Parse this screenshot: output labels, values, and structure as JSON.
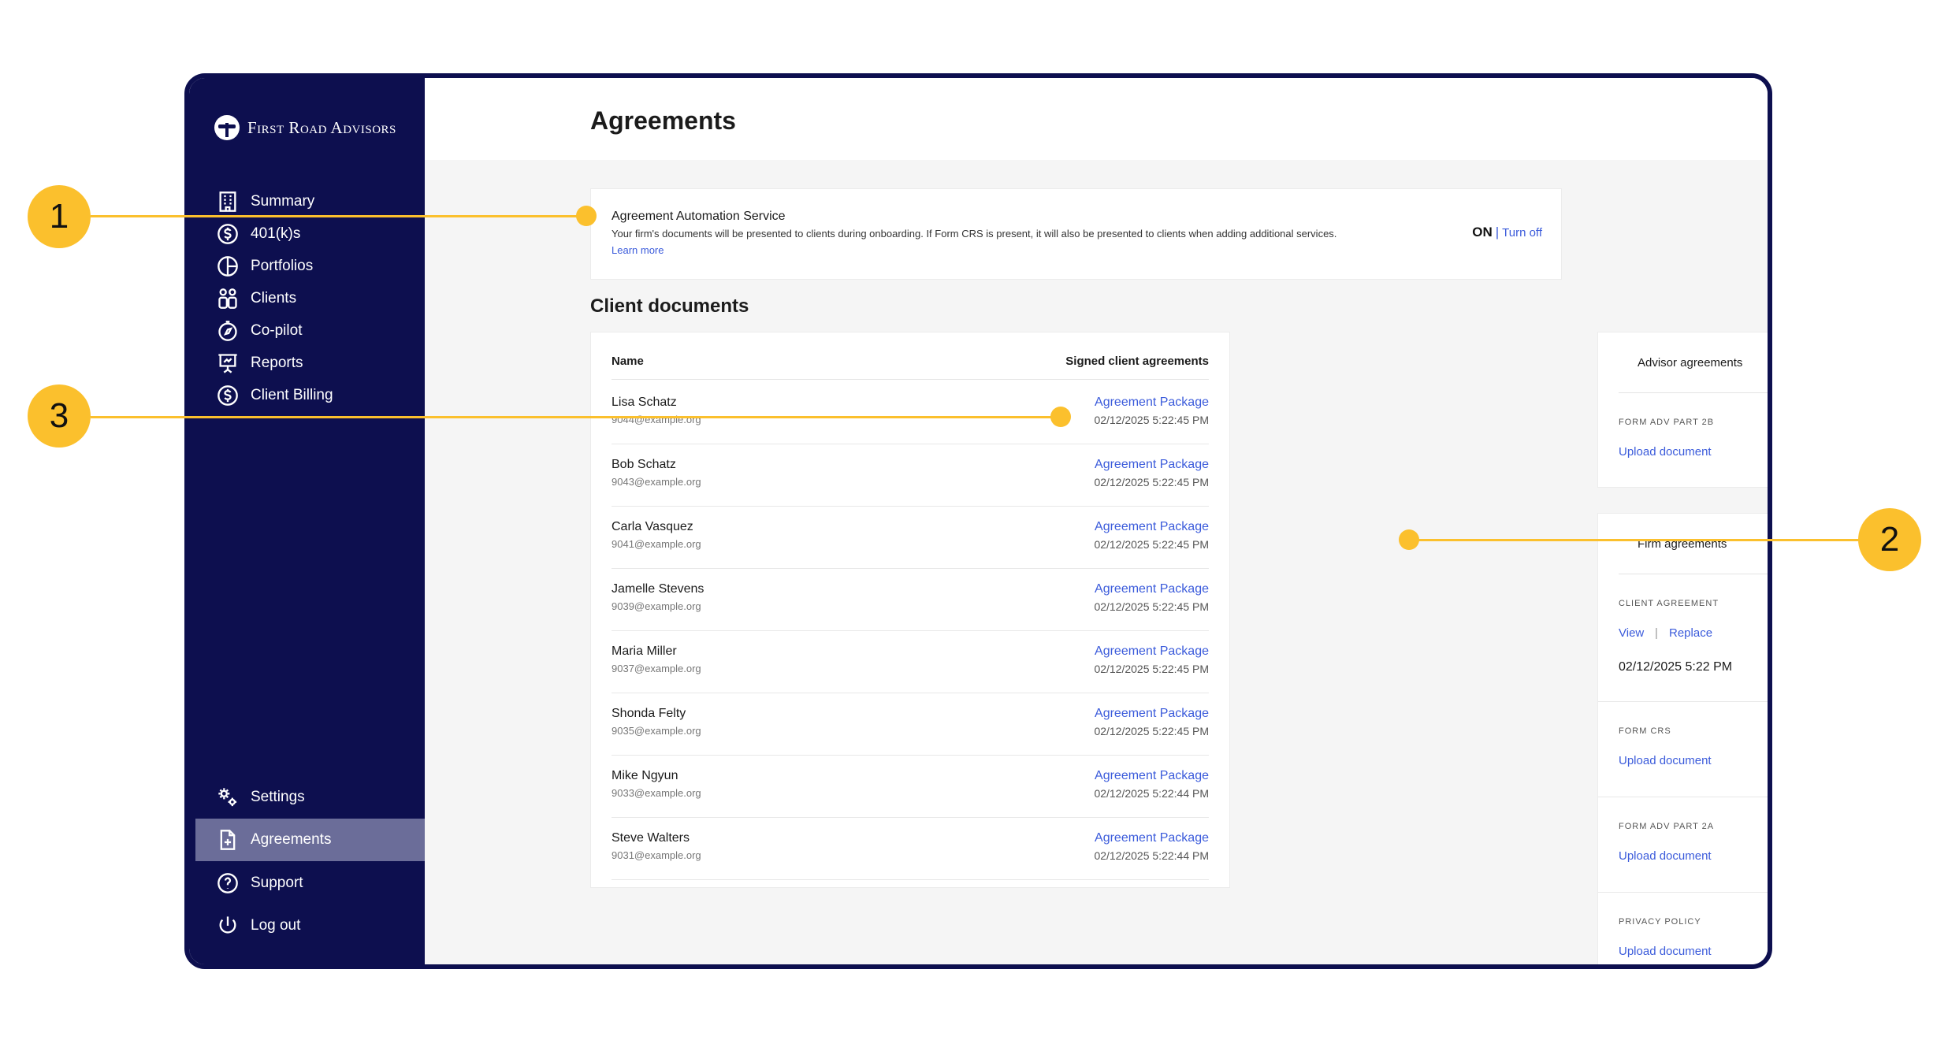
{
  "brand": {
    "name": "First Road Advisors"
  },
  "sidebar": {
    "items": [
      {
        "label": "Summary",
        "icon": "building-icon"
      },
      {
        "label": "401(k)s",
        "icon": "dollar-circle-icon"
      },
      {
        "label": "Portfolios",
        "icon": "pie-chart-icon"
      },
      {
        "label": "Clients",
        "icon": "people-icon"
      },
      {
        "label": "Co-pilot",
        "icon": "compass-icon"
      },
      {
        "label": "Reports",
        "icon": "presentation-icon"
      },
      {
        "label": "Client Billing",
        "icon": "dollar-circle-icon"
      }
    ],
    "bottom_items": [
      {
        "label": "Settings",
        "icon": "gears-icon"
      },
      {
        "label": "Agreements",
        "icon": "document-plus-icon",
        "active": true
      },
      {
        "label": "Support",
        "icon": "question-circle-icon"
      },
      {
        "label": "Log out",
        "icon": "power-icon"
      }
    ]
  },
  "page": {
    "title": "Agreements"
  },
  "automation": {
    "title": "Agreement Automation Service",
    "description": "Your firm's documents will be presented to clients during onboarding. If Form CRS is present, it will also be presented to clients when adding additional services.",
    "learn_more": "Learn more",
    "status": "ON",
    "separator": "|",
    "toggle_label": "Turn off"
  },
  "client_documents": {
    "title": "Client documents",
    "col_name": "Name",
    "col_signed": "Signed client agreements",
    "rows": [
      {
        "name": "Lisa Schatz",
        "email": "9044@example.org",
        "package": "Agreement Package",
        "date": "02/12/2025 5:22:45 PM"
      },
      {
        "name": "Bob Schatz",
        "email": "9043@example.org",
        "package": "Agreement Package",
        "date": "02/12/2025 5:22:45 PM"
      },
      {
        "name": "Carla Vasquez",
        "email": "9041@example.org",
        "package": "Agreement Package",
        "date": "02/12/2025 5:22:45 PM"
      },
      {
        "name": "Jamelle Stevens",
        "email": "9039@example.org",
        "package": "Agreement Package",
        "date": "02/12/2025 5:22:45 PM"
      },
      {
        "name": "Maria Miller",
        "email": "9037@example.org",
        "package": "Agreement Package",
        "date": "02/12/2025 5:22:45 PM"
      },
      {
        "name": "Shonda Felty",
        "email": "9035@example.org",
        "package": "Agreement Package",
        "date": "02/12/2025 5:22:45 PM"
      },
      {
        "name": "Mike Ngyun",
        "email": "9033@example.org",
        "package": "Agreement Package",
        "date": "02/12/2025 5:22:44 PM"
      },
      {
        "name": "Steve Walters",
        "email": "9031@example.org",
        "package": "Agreement Package",
        "date": "02/12/2025 5:22:44 PM"
      }
    ]
  },
  "advisor_agreements": {
    "title": "Advisor agreements",
    "form_label": "FORM ADV PART 2B",
    "upload": "Upload document"
  },
  "firm_agreements": {
    "title": "Firm agreements",
    "client_agreement_label": "CLIENT AGREEMENT",
    "view": "View",
    "separator": "|",
    "replace": "Replace",
    "client_agreement_date": "02/12/2025 5:22 PM",
    "form_crs_label": "FORM CRS",
    "form_crs_upload": "Upload document",
    "adv2a_label": "FORM ADV PART 2A",
    "adv2a_upload": "Upload document",
    "privacy_label": "PRIVACY POLICY",
    "privacy_upload": "Upload document"
  },
  "callouts": {
    "one": "1",
    "two": "2",
    "three": "3"
  },
  "colors": {
    "sidebar": "#0d0f4f",
    "accent": "#3b5bdb",
    "callout": "#fbc02d",
    "active_nav": "#6b6d99"
  }
}
